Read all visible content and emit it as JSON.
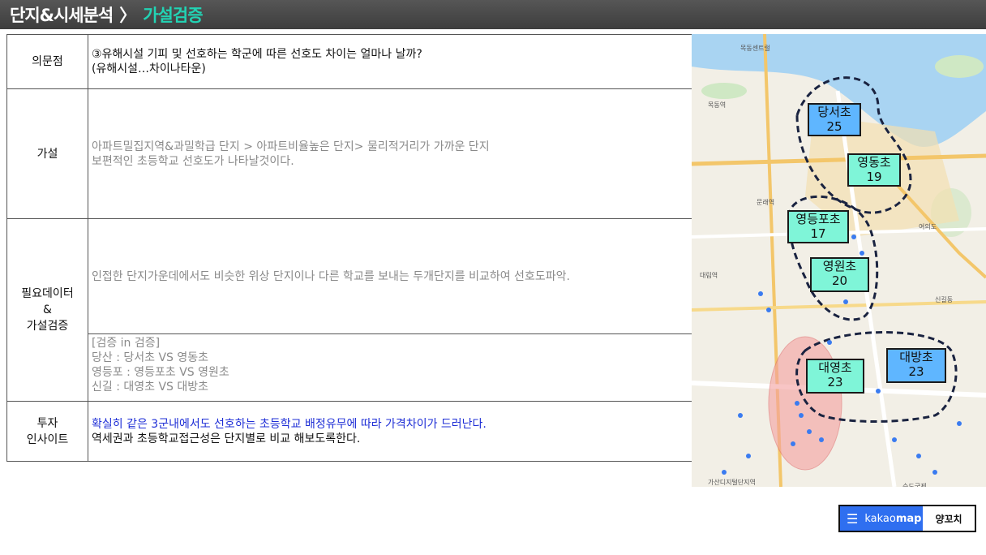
{
  "header": {
    "section": "단지&시세분석",
    "separator": "〉",
    "title": "가설검증"
  },
  "table": {
    "rows": {
      "question": {
        "label": "의문점",
        "line1": "③유해시설 기피 및 선호하는 학군에 따른 선호도 차이는 얼마나 날까?",
        "line2": "(유해시설…차이나타운)"
      },
      "hypothesis": {
        "label": "가설",
        "line1": "아파트밀집지역&과밀학급  단지 > 아파트비율높은  단지> 물리적거리가  가까운 단지",
        "line2": "보편적인 초등학교 선호도가 나타날것이다."
      },
      "data": {
        "label1": "필요데이터",
        "label2": "&",
        "label3": "가설검증",
        "main": "인접한 단지가운데에서도  비슷한 위상 단지이나 다른 학교를 보내는 두개단지를 비교하여 선호도파악.",
        "verify_title": "[검증 in 검증]",
        "verify_1": "당산 : 당서초 VS 영동초",
        "verify_2": "영등포 : 영등포초 VS 영원초",
        "verify_3": "신길 : 대영초 VS 대방초"
      },
      "insight": {
        "label1": "투자",
        "label2": "인사이트",
        "line1": "확실히 같은 3군내에서도 선호하는 초등학교 배정유무에 따라 가격차이가 드러난다.",
        "line2": "역세권과 초등학교접근성은 단지별로 비교 해보도록한다."
      }
    }
  },
  "map": {
    "schools": [
      {
        "name": "당서초",
        "count": "25",
        "color": "#5fb6ff"
      },
      {
        "name": "영동초",
        "count": "19",
        "color": "#7ff5d8"
      },
      {
        "name": "영등포초",
        "count": "17",
        "color": "#7ff5d8"
      },
      {
        "name": "영원초",
        "count": "20",
        "color": "#7ff5d8"
      },
      {
        "name": "대영초",
        "count": "23",
        "color": "#7ff5d8"
      },
      {
        "name": "대방초",
        "count": "23",
        "color": "#5fb6ff"
      }
    ]
  },
  "kakao": {
    "brand_light": "kakao",
    "brand_bold": "map",
    "place": "양꼬치",
    "menu_icon": "hamburger-menu-icon"
  },
  "colors": {
    "title_accent": "#22d3b4",
    "insight_blue": "#1f2fd6",
    "kakao_blue": "#2f6ff0",
    "school_blue": "#5fb6ff",
    "school_green": "#7ff5d8"
  }
}
